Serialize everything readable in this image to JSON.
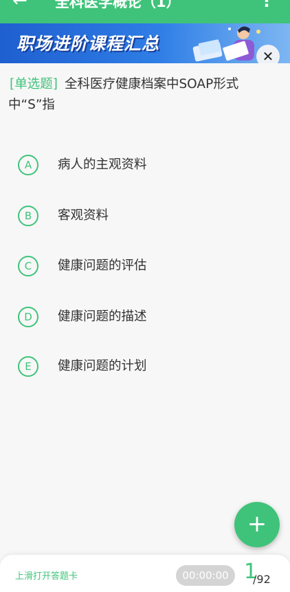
{
  "appbar": {
    "back_icon": "arrow-left-icon",
    "title": "全科医学概论（1）",
    "more_icon": "more-vertical-icon"
  },
  "banner": {
    "text": "职场进阶课程汇总",
    "close_icon": "close-icon"
  },
  "question": {
    "type": "[单选题]",
    "text": "全科医疗健康档案中SOAP形式中“S”指"
  },
  "options": [
    {
      "letter": "A",
      "text": "病人的主观资料"
    },
    {
      "letter": "B",
      "text": "客观资料"
    },
    {
      "letter": "C",
      "text": "健康问题的评估"
    },
    {
      "letter": "D",
      "text": "健康问题的描述"
    },
    {
      "letter": "E",
      "text": "健康问题的计划"
    }
  ],
  "fab": {
    "icon": "plus-icon",
    "label": "+"
  },
  "bottom": {
    "hint": "上滑打开答题卡",
    "timer": "00:00:00",
    "current": "1",
    "total": "/92"
  },
  "colors": {
    "accent": "#3fc37a",
    "banner": "#2f7ee6"
  }
}
